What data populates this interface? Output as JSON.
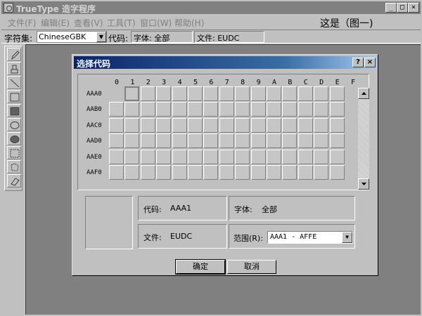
{
  "window": {
    "title": "TrueType 造字程序",
    "minimize_glyph": "_",
    "maximize_glyph": "□",
    "close_glyph": "×"
  },
  "menu": {
    "items": [
      {
        "label": "文件(F)"
      },
      {
        "label": "编辑(E)"
      },
      {
        "label": "查看(V)"
      },
      {
        "label": "工具(T)"
      },
      {
        "label": "窗口(W)"
      },
      {
        "label": "帮助(H)"
      }
    ],
    "caption": "这是（图一)"
  },
  "toolbar": {
    "charset_label": "字符集:",
    "charset_value": "ChineseGBK",
    "code_label": "代码:",
    "font_field": "字体: 全部",
    "file_field": "文件: EUDC"
  },
  "palette": {
    "tools": [
      {
        "icon": "pencil-icon"
      },
      {
        "icon": "brush-icon"
      },
      {
        "icon": "line-icon"
      },
      {
        "icon": "hollow-rectangle-icon"
      },
      {
        "icon": "filled-rectangle-icon"
      },
      {
        "icon": "hollow-ellipse-icon"
      },
      {
        "icon": "filled-ellipse-icon"
      },
      {
        "icon": "rect-select-icon"
      },
      {
        "icon": "freeform-select-icon"
      },
      {
        "icon": "eraser-icon"
      }
    ]
  },
  "dialog": {
    "title": "选择代码",
    "help_glyph": "?",
    "close_glyph": "×",
    "columns": [
      "0",
      "1",
      "2",
      "3",
      "4",
      "5",
      "6",
      "7",
      "8",
      "9",
      "A",
      "B",
      "C",
      "D",
      "E",
      "F"
    ],
    "rows": [
      "AAA0",
      "AAB0",
      "AAC0",
      "AAD0",
      "AAE0",
      "AAF0"
    ],
    "selected_cell": {
      "row": 0,
      "col": 1
    },
    "code_label": "代码:",
    "code_value": "AAA1",
    "font_label": "字体:",
    "font_value": "全部",
    "file_label": "文件:",
    "file_value": "EUDC",
    "range_label": "范围(R):",
    "range_value": "AAA1 - AFFE",
    "ok_label": "确定",
    "cancel_label": "取消"
  }
}
